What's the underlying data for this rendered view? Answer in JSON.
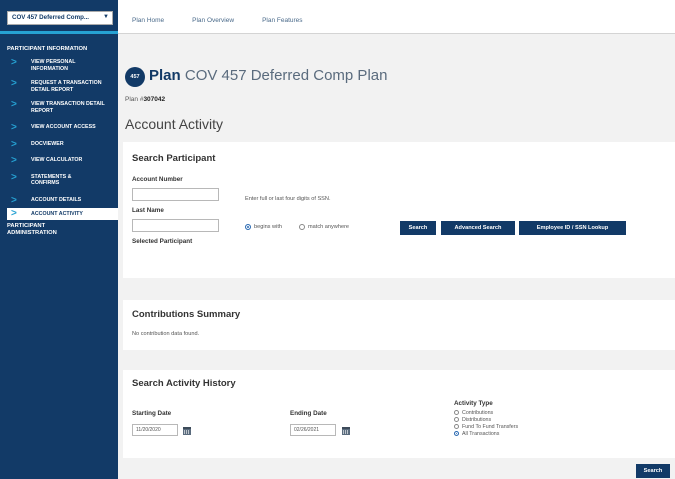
{
  "plan_selector": {
    "label": "COV 457 Deferred Comp...",
    "caret": "▼"
  },
  "topnav": [
    "Plan Home",
    "Plan Overview",
    "Plan Features"
  ],
  "sidebar": {
    "participant_info_heading": "PARTICIPANT INFORMATION",
    "items": [
      {
        "label": "VIEW PERSONAL INFORMATION",
        "active": false
      },
      {
        "label": "REQUEST A TRANSACTION DETAIL REPORT",
        "active": false
      },
      {
        "label": "VIEW TRANSACTION DETAIL REPORT",
        "active": false
      },
      {
        "label": "VIEW ACCOUNT ACCESS",
        "active": false
      },
      {
        "label": "DOCVIEWER",
        "active": false
      },
      {
        "label": "VIEW CALCULATOR",
        "active": false
      },
      {
        "label": "STATEMENTS & CONFIRMS",
        "active": false
      },
      {
        "label": "ACCOUNT DETAILS",
        "active": false
      },
      {
        "label": "ACCOUNT ACTIVITY",
        "active": true
      }
    ],
    "admin_heading": "PARTICIPANT ADMINISTRATION",
    "chevron": ">"
  },
  "plan": {
    "logo_text": "457",
    "title_prefix": "Plan",
    "title_name": "COV 457 Deferred Comp Plan",
    "number_label": "Plan #",
    "number_value": "307042"
  },
  "page_title": "Account Activity",
  "search_participant": {
    "title": "Search Participant",
    "account_number_label": "Account Number",
    "account_number_value": "",
    "last_name_label": "Last Name",
    "last_name_value": "",
    "selected_participant_label": "Selected Participant",
    "ssn_hint": "Enter full or last four digits of SSN.",
    "match_options": [
      {
        "label": "begins with",
        "selected": true
      },
      {
        "label": "match anywhere",
        "selected": false
      }
    ],
    "buttons": {
      "search": "Search",
      "advanced_search": "Advanced Search",
      "employee_lookup": "Employee ID / SSN Lookup"
    }
  },
  "contributions_summary": {
    "title": "Contributions Summary",
    "empty_message": "No contribution data found."
  },
  "search_activity_history": {
    "title": "Search Activity History",
    "starting_date_label": "Starting Date",
    "starting_date_value": "11/20/2020",
    "ending_date_label": "Ending Date",
    "ending_date_value": "02/26/2021",
    "activity_type_label": "Activity Type",
    "activity_types": [
      {
        "label": "Contributions",
        "selected": false
      },
      {
        "label": "Distributions",
        "selected": false
      },
      {
        "label": "Fund To Fund Transfers",
        "selected": false
      },
      {
        "label": "All Transactions",
        "selected": true
      }
    ],
    "search_button": "Search"
  },
  "colors": {
    "navy": "#123a67",
    "accent_blue": "#26a2d3",
    "background": "#f2f2f2"
  }
}
